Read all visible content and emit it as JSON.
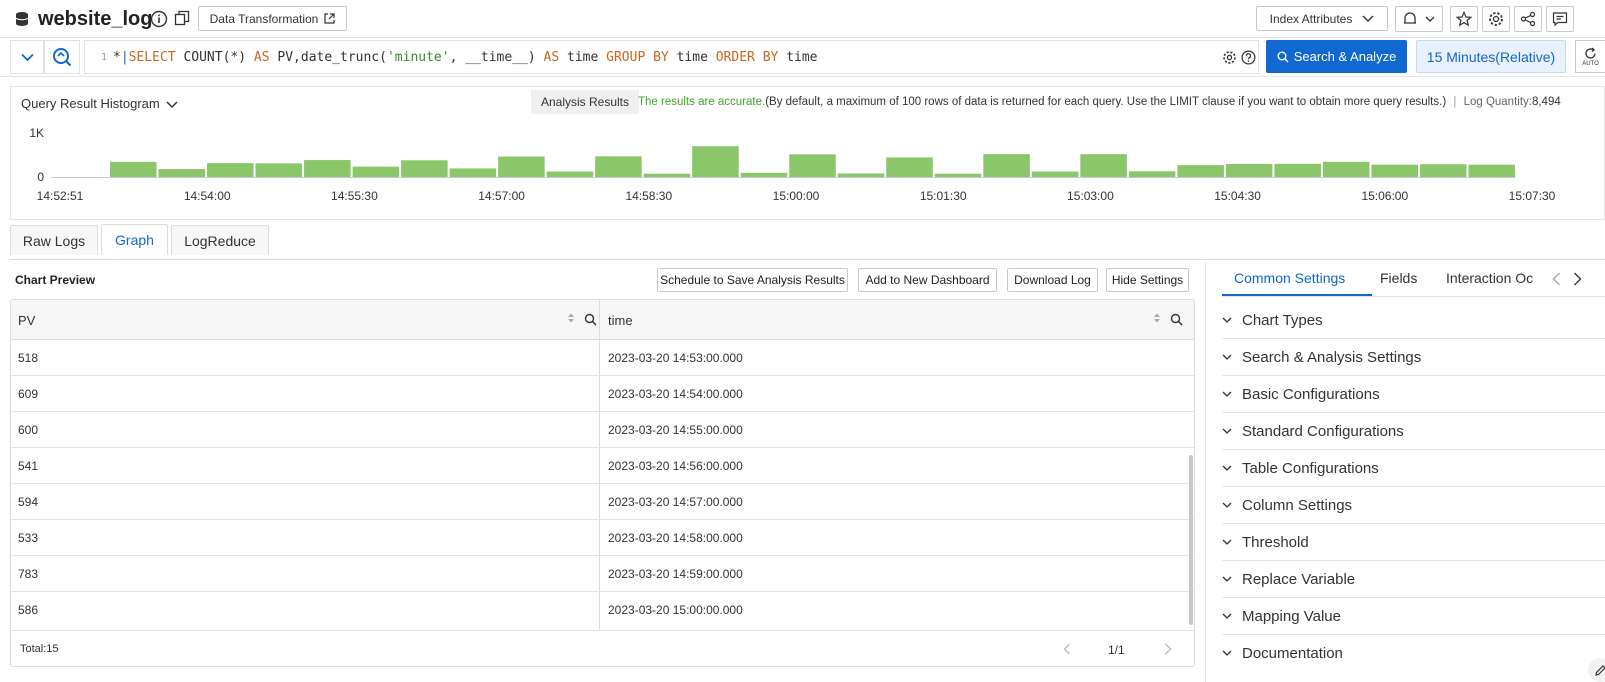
{
  "header": {
    "logstore_name": "website_log",
    "data_transformation_label": "Data Transformation",
    "index_attributes_label": "Index Attributes"
  },
  "query": {
    "line_number": "1",
    "star": "*",
    "pipe": "|",
    "select": "SELECT",
    "count_expr": "COUNT(*)",
    "as1": "AS",
    "pv_alias": "PV,date_trunc(",
    "minute_str": "'minute'",
    "time_arg": ", __time__)",
    "as2": "AS",
    "time_alias": "time",
    "group": "GROUP",
    "by1": "BY",
    "group_field": "time",
    "order": "ORDER",
    "by2": "BY",
    "order_field": "time",
    "search_button_label": "Search & Analyze",
    "time_range_label": "15 Minutes(Relative)",
    "auto_label": "AUTO"
  },
  "histogram": {
    "title": "Query Result Histogram",
    "analysis_tag": "Analysis Results",
    "accurate_text": "The results are accurate.",
    "note_text": "(By default, a maximum of 100 rows of data is returned for each query. Use the LIMIT clause if you want to obtain more query results.)",
    "separator": "|",
    "log_quantity_label": "Log Quantity:",
    "log_quantity_value": "8,494",
    "bar_color": "#8bc76a"
  },
  "chart_data": {
    "type": "bar",
    "title": "Query Result Histogram",
    "ytick_labels": [
      "1K",
      "0"
    ],
    "xtick_labels": [
      "14:52:51",
      "14:54:00",
      "14:55:30",
      "14:57:00",
      "14:58:30",
      "15:00:00",
      "15:01:30",
      "15:03:00",
      "15:04:30",
      "15:06:00",
      "15:07:30"
    ],
    "ylim": [
      0,
      1000
    ],
    "values": [
      345,
      180,
      315,
      310,
      385,
      235,
      380,
      195,
      465,
      125,
      470,
      75,
      700,
      95,
      515,
      80,
      445,
      75,
      520,
      125,
      520,
      130,
      270,
      295,
      300,
      345,
      280,
      290,
      280
    ]
  },
  "tabs": [
    {
      "label": "Raw Logs"
    },
    {
      "label": "Graph"
    },
    {
      "label": "LogReduce"
    }
  ],
  "preview": {
    "title": "Chart Preview",
    "schedule_label": "Schedule to Save Analysis Results",
    "add_dashboard_label": "Add to New Dashboard",
    "download_label": "Download Log",
    "hide_settings_label": "Hide Settings"
  },
  "table": {
    "columns": [
      "PV",
      "time"
    ],
    "rows": [
      [
        "518",
        "2023-03-20 14:53:00.000"
      ],
      [
        "609",
        "2023-03-20 14:54:00.000"
      ],
      [
        "600",
        "2023-03-20 14:55:00.000"
      ],
      [
        "541",
        "2023-03-20 14:56:00.000"
      ],
      [
        "594",
        "2023-03-20 14:57:00.000"
      ],
      [
        "533",
        "2023-03-20 14:58:00.000"
      ],
      [
        "783",
        "2023-03-20 14:59:00.000"
      ],
      [
        "586",
        "2023-03-20 15:00:00.000"
      ]
    ],
    "total_label": "Total:15",
    "page_label": "1/1"
  },
  "settings": {
    "tabs": [
      "Common Settings",
      "Fields",
      "Interaction Oc"
    ],
    "sections": [
      "Chart Types",
      "Search & Analysis Settings",
      "Basic Configurations",
      "Standard Configurations",
      "Table Configurations",
      "Column Settings",
      "Threshold",
      "Replace Variable",
      "Mapping Value",
      "Documentation"
    ]
  }
}
